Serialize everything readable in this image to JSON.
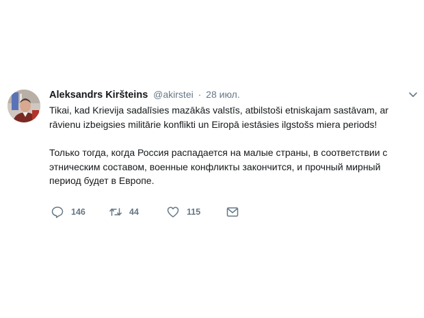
{
  "tweet": {
    "author_name": "Aleksandrs Kiršteins",
    "author_handle": "@akirstei",
    "separator": "·",
    "timestamp": "28 июл.",
    "text_lv": [
      "Tikai, kad Krievija sadalīsies mazākās valstīs, atbilstoši etniskajam sastāvam, ar",
      "rāvienu izbeigsies militārie konflikti un Eiropā iestāsies ilgstošs miera periods!"
    ],
    "text_ru": [
      "Только тогда, когда Россия распадается на малые страны, в соответствии с",
      "этническим составом, военные конфликты закончится, и прочный мирный",
      "период будет в Европе."
    ]
  },
  "actions": {
    "reply": {
      "icon": "reply-icon",
      "count": "146"
    },
    "retweet": {
      "icon": "retweet-icon",
      "count": "44"
    },
    "like": {
      "icon": "heart-icon",
      "count": "115"
    },
    "dm": {
      "icon": "envelope-icon"
    }
  },
  "colors": {
    "text": "#14171a",
    "secondary": "#657786",
    "background": "#ffffff"
  }
}
